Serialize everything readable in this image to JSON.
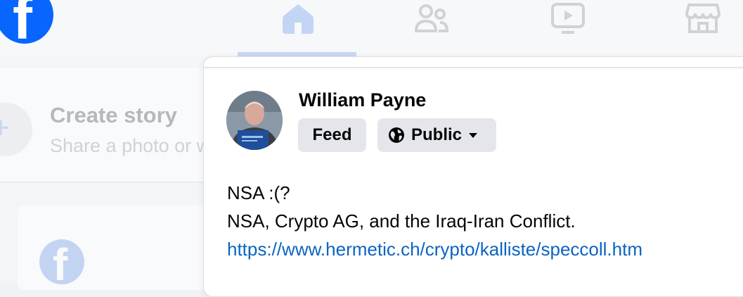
{
  "nav": {
    "logo_letter": "f",
    "icons": [
      "home-icon",
      "friends-icon",
      "video-icon",
      "marketplace-icon"
    ],
    "active_tab": "home"
  },
  "feed": {
    "create_story_title": "Create story",
    "create_story_subtitle": "Share a photo or write something.",
    "post_logo_letter": "f"
  },
  "dialog": {
    "user_name": "William Payne",
    "audience_feed_label": "Feed",
    "audience_privacy_label": "Public",
    "post_lines": [
      "NSA :(?",
      "NSA, Crypto AG, and the Iraq-Iran Conflict."
    ],
    "post_link": "https://www.hermetic.ch/crypto/kalliste/speccoll.htm"
  },
  "colors": {
    "brand": "#0866ff",
    "link": "#0a64c2",
    "pill_bg": "#e4e6eb"
  }
}
